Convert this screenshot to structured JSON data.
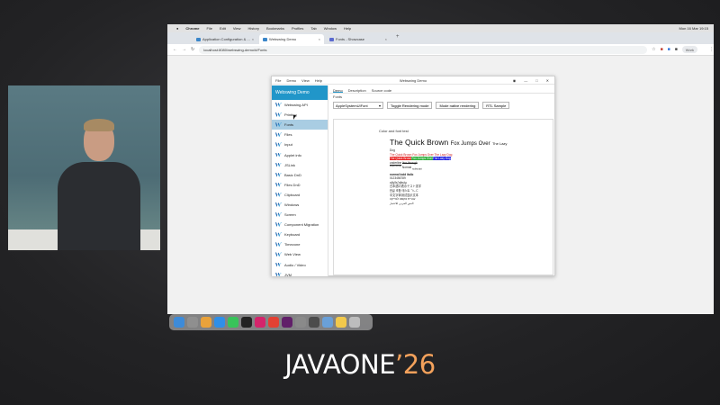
{
  "mac_menubar": {
    "apple": "",
    "items": [
      "Chrome",
      "File",
      "Edit",
      "View",
      "History",
      "Bookmarks",
      "Profiles",
      "Tab",
      "Window",
      "Help"
    ],
    "clock": "Mon 16 Mar 19:15"
  },
  "browser": {
    "tabs": [
      {
        "label": "Application Configuration & ...",
        "active": false
      },
      {
        "label": "Webswing Demo",
        "active": true
      },
      {
        "label": "Fonts - Showcase",
        "active": false
      }
    ],
    "new_tab_label": "+",
    "nav": {
      "back": "←",
      "forward": "→",
      "reload": "↻"
    },
    "url": "localhost:8080/webswing-demo/#/Fonts",
    "profile_label": "Work"
  },
  "app": {
    "menus": [
      "File",
      "Demo",
      "View",
      "Help"
    ],
    "window_title": "Webswing Demo",
    "controls": {
      "minimize": "—",
      "maximize": "□",
      "close": "✕"
    },
    "sidebar_header": "Webswing Demo",
    "sidebar_items": [
      {
        "label": "Webswing API",
        "active": false
      },
      {
        "label": "Printing",
        "active": false
      },
      {
        "label": "Fonts",
        "active": true
      },
      {
        "label": "Files",
        "active": false
      },
      {
        "label": "Input",
        "active": false
      },
      {
        "label": "Applet info",
        "active": false
      },
      {
        "label": "JSLink",
        "active": false
      },
      {
        "label": "Basic DnD",
        "active": false
      },
      {
        "label": "Files DnD",
        "active": false
      },
      {
        "label": "Clipboard",
        "active": false
      },
      {
        "label": "Windows",
        "active": false
      },
      {
        "label": "Screen",
        "active": false
      },
      {
        "label": "Component Migration",
        "active": false
      },
      {
        "label": "Keyboard",
        "active": false
      },
      {
        "label": "Timezone",
        "active": false
      },
      {
        "label": "Web View",
        "active": false
      },
      {
        "label": "Audio / Video",
        "active": false
      },
      {
        "label": "JVM",
        "active": false
      }
    ],
    "main_tabs": [
      {
        "label": "Demo",
        "active": true
      },
      {
        "label": "Description",
        "active": false
      },
      {
        "label": "Source code",
        "active": false
      }
    ],
    "sub_tab": "Fonts",
    "font_select": "AppleSystemUIFont",
    "buttons": {
      "toggle_rendering": "Toggle Rendering mode",
      "mode_native": "Mode native rendering",
      "rtl_sample": "RTL Sample"
    },
    "demo": {
      "caption": "Color and font test",
      "big_text": "The Quick Brown",
      "big_text_tail": "Fox Jumps Over",
      "big_text_small": "The Lazy",
      "dog": "Dog",
      "line_red": "The Quick Brown Fox Jumps Over The Lazy Dog",
      "hl_red": "The Quick Brown",
      "hl_green": "Fox Jumps Over",
      "hl_blue": "The Lazy Dog",
      "underline": "underline",
      "strikethrough": "line through",
      "superscript": "superscript",
      "normal": "Normal",
      "subscript": "subscript",
      "normal_bold": "normal bold italic",
      "digits": "0123456789",
      "symbols": "αβγδεζηθικλμ",
      "cjk1": "日本語の表示テスト漢字",
      "cjk2": "한글 조합 테스트 ㄱㄴㄷ",
      "cjk3": "中文字体测试显示文本",
      "hebrew": "עברית טקסט לבדיקה",
      "arabic": "النص العربي للاختبار"
    }
  },
  "dock": {
    "icons": [
      "finder-icon",
      "launchpad-icon",
      "photos-icon",
      "safari-icon",
      "messages-icon",
      "terminal-icon",
      "intellij-icon",
      "chrome-icon",
      "slack-icon",
      "settings-icon",
      "activity-icon",
      "preview-icon",
      "notes-icon",
      "trash-icon"
    ]
  },
  "branding": {
    "text": "JAVAONE",
    "year": "’26"
  }
}
